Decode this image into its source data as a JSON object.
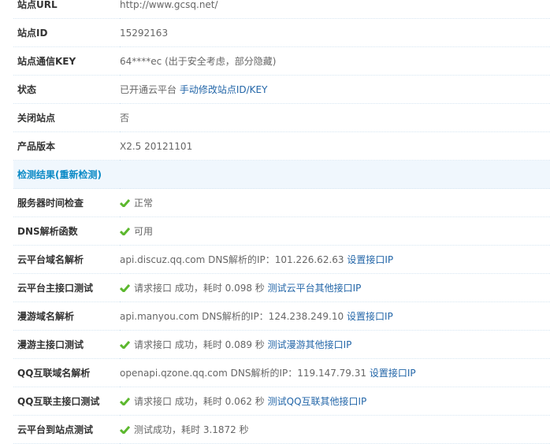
{
  "rows": [
    {
      "label": "站点URL",
      "text": "http://www.gcsq.net/"
    },
    {
      "label": "站点ID",
      "text": "15292163"
    },
    {
      "label": "站点通信KEY",
      "text": "64****ec (出于安全考虑，部分隐藏)"
    },
    {
      "label": "状态",
      "text": "已开通云平台 ",
      "link": "手动修改站点ID/KEY"
    },
    {
      "label": "关闭站点",
      "text": "否"
    },
    {
      "label": "产品版本",
      "text": "X2.5 20121101"
    }
  ],
  "section_header": {
    "title": "检测结果",
    "relink": "(重新检测)"
  },
  "checks": [
    {
      "label": "服务器时间检查",
      "ok": true,
      "text": "正常"
    },
    {
      "label": "DNS解析函数",
      "ok": true,
      "text": "可用"
    },
    {
      "label": "云平台域名解析",
      "ok": false,
      "text": "api.discuz.qq.com DNS解析的IP：101.226.62.63 ",
      "link": "设置接口IP"
    },
    {
      "label": "云平台主接口测试",
      "ok": true,
      "text": "请求接口 成功，耗时 0.098 秒 ",
      "link": "测试云平台其他接口IP"
    },
    {
      "label": "漫游域名解析",
      "ok": false,
      "text": "api.manyou.com DNS解析的IP：124.238.249.10 ",
      "link": "设置接口IP"
    },
    {
      "label": "漫游主接口测试",
      "ok": true,
      "text": "请求接口 成功，耗时 0.089 秒 ",
      "link": "测试漫游其他接口IP"
    },
    {
      "label": "QQ互联域名解析",
      "ok": false,
      "text": "openapi.qzone.qq.com DNS解析的IP：119.147.79.31 ",
      "link": "设置接口IP"
    },
    {
      "label": "QQ互联主接口测试",
      "ok": true,
      "text": "请求接口 成功，耗时 0.062 秒 ",
      "link": "测试QQ互联其他接口IP"
    },
    {
      "label": "云平台到站点测试",
      "ok": true,
      "text": "测试成功，耗时 3.1872 秒"
    }
  ]
}
